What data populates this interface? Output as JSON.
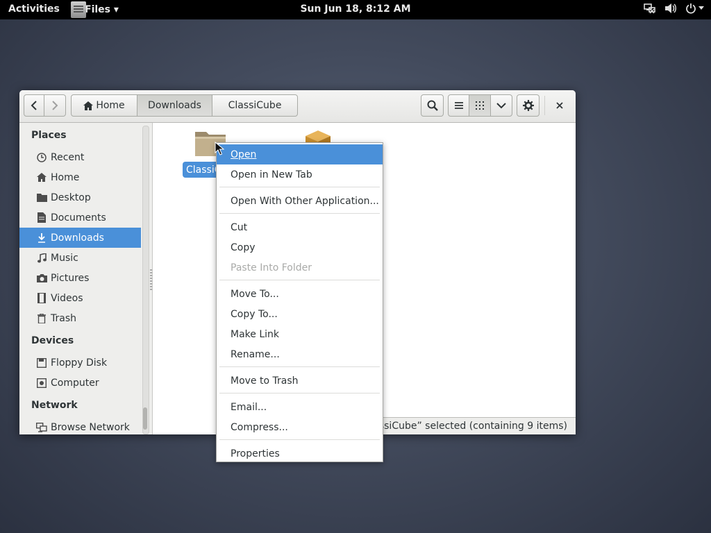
{
  "topbar": {
    "activities": "Activities",
    "app_menu": "Files ▾",
    "clock": "Sun Jun 18,  8:12 AM"
  },
  "window": {
    "breadcrumbs": [
      "Home",
      "Downloads",
      "ClassiCube"
    ],
    "status": "“ClassiCube” selected  (containing 9 items)",
    "status_visible": "lassiCube” selected  (containing 9 items)"
  },
  "sidebar": {
    "sections": {
      "places": "Places",
      "devices": "Devices",
      "network": "Network"
    },
    "places": [
      {
        "label": "Recent",
        "icon": "clock-icon"
      },
      {
        "label": "Home",
        "icon": "home-icon"
      },
      {
        "label": "Desktop",
        "icon": "folder-icon"
      },
      {
        "label": "Documents",
        "icon": "document-icon"
      },
      {
        "label": "Downloads",
        "icon": "download-icon",
        "selected": true
      },
      {
        "label": "Music",
        "icon": "music-icon"
      },
      {
        "label": "Pictures",
        "icon": "camera-icon"
      },
      {
        "label": "Videos",
        "icon": "film-icon"
      },
      {
        "label": "Trash",
        "icon": "trash-icon"
      }
    ],
    "devices": [
      {
        "label": "Floppy Disk",
        "icon": "floppy-icon"
      },
      {
        "label": "Computer",
        "icon": "computer-icon"
      }
    ],
    "network": [
      {
        "label": "Browse Network",
        "icon": "network-icon"
      }
    ]
  },
  "files": [
    {
      "label": "ClassiC",
      "icon": "folder-icon",
      "selected": true
    },
    {
      "label": "",
      "icon": "package-icon"
    }
  ],
  "context_menu": {
    "items": [
      {
        "label": "Open",
        "active": true
      },
      {
        "label": "Open in New Tab"
      },
      {
        "label": "Open With Other Application..."
      },
      {
        "label": "Cut"
      },
      {
        "label": "Copy"
      },
      {
        "label": "Paste Into Folder",
        "disabled": true
      },
      {
        "label": "Move To..."
      },
      {
        "label": "Copy To..."
      },
      {
        "label": "Make Link"
      },
      {
        "label": "Rename..."
      },
      {
        "label": "Move to Trash"
      },
      {
        "label": "Email..."
      },
      {
        "label": "Compress..."
      },
      {
        "label": "Properties"
      }
    ]
  },
  "colors": {
    "accent": "#4a90d9",
    "topbar": "#000000",
    "sidebar": "#eeeeec"
  }
}
